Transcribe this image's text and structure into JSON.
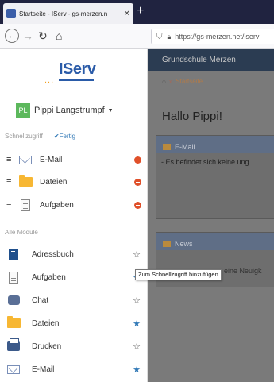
{
  "browser": {
    "tab_title": "Startseite - IServ - gs-merzen.n",
    "tab_close": "✕",
    "new_tab": "+",
    "url": "https://gs-merzen.net/iserv"
  },
  "sidebar": {
    "logo": "IServ",
    "user": {
      "initials": "PL",
      "name": "Pippi Langstrumpf"
    },
    "quick_access": {
      "heading": "Schnellzugriff",
      "done_label": "✔Fertig",
      "items": [
        {
          "label": "E-Mail",
          "icon": "mail-icon"
        },
        {
          "label": "Dateien",
          "icon": "folder-icon"
        },
        {
          "label": "Aufgaben",
          "icon": "document-icon"
        }
      ]
    },
    "modules": {
      "heading": "Alle Module",
      "items": [
        {
          "label": "Adressbuch",
          "icon": "address-book-icon",
          "starred": false
        },
        {
          "label": "Aufgaben",
          "icon": "document-icon",
          "starred": true
        },
        {
          "label": "Chat",
          "icon": "chat-icon",
          "starred": false
        },
        {
          "label": "Dateien",
          "icon": "folder-icon",
          "starred": true
        },
        {
          "label": "Drucken",
          "icon": "printer-icon",
          "starred": false
        },
        {
          "label": "E-Mail",
          "icon": "mail-icon",
          "starred": true
        }
      ]
    },
    "tooltip": "Zum Schnellzugriff hinzufügen"
  },
  "main": {
    "school_name": "Grundschule Merzen",
    "breadcrumb": {
      "separator": "»",
      "current": "Startseite"
    },
    "greeting": "Hallo Pippi!",
    "email_panel": {
      "title": "E-Mail",
      "body": "- Es befindet sich keine ung"
    },
    "news_panel": {
      "title": "News",
      "body": "eine Neuigk"
    }
  },
  "colors": {
    "accent": "#337ab7",
    "remove": "#e0502a",
    "school_bar": "#2b3c52",
    "avatar": "#5cb85c"
  }
}
